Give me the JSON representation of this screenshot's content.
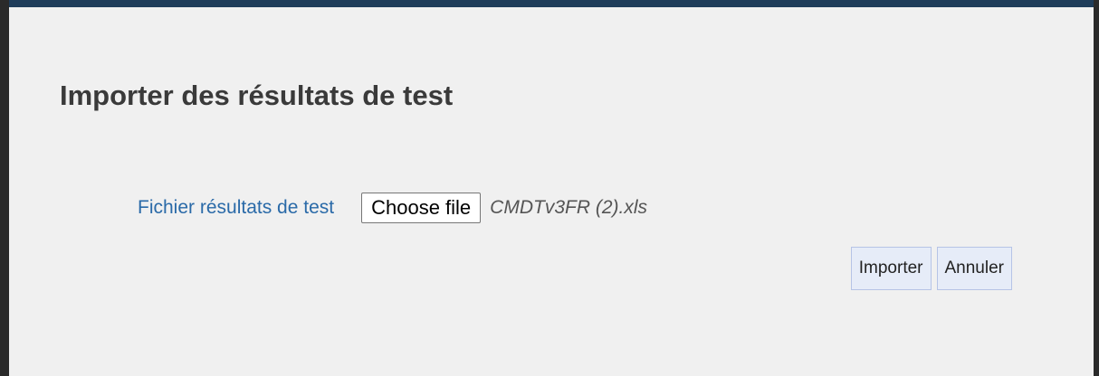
{
  "dialog": {
    "title": "Importer des résultats de test",
    "field_label": "Fichier résultats de test",
    "choose_file_label": "Choose file",
    "selected_file": "CMDTv3FR (2).xls",
    "import_label": "Importer",
    "cancel_label": "Annuler"
  },
  "colors": {
    "dialog_background": "#f0f0f0",
    "label_color": "#2a6aa8",
    "button_background": "#e6ecf8",
    "button_border": "#b6c4e6"
  }
}
